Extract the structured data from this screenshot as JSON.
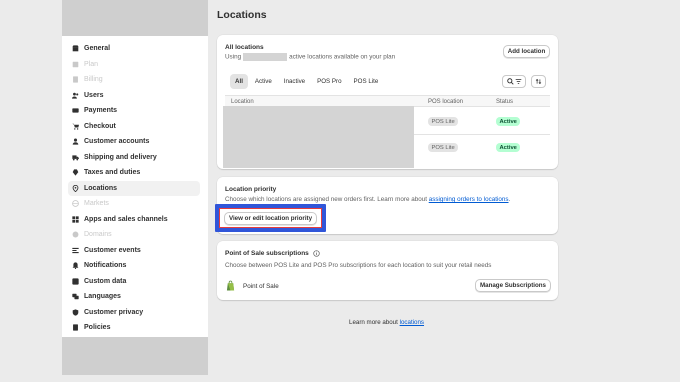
{
  "sidebar": {
    "items": [
      {
        "label": "General",
        "icon": "store-icon",
        "state": "normal"
      },
      {
        "label": "Plan",
        "icon": "plan-icon",
        "state": "disabled"
      },
      {
        "label": "Billing",
        "icon": "billing-icon",
        "state": "disabled"
      },
      {
        "label": "Users",
        "icon": "users-icon",
        "state": "normal"
      },
      {
        "label": "Payments",
        "icon": "payments-icon",
        "state": "normal"
      },
      {
        "label": "Checkout",
        "icon": "cart-icon",
        "state": "normal"
      },
      {
        "label": "Customer accounts",
        "icon": "person-icon",
        "state": "normal"
      },
      {
        "label": "Shipping and delivery",
        "icon": "truck-icon",
        "state": "normal"
      },
      {
        "label": "Taxes and duties",
        "icon": "tax-icon",
        "state": "normal"
      },
      {
        "label": "Locations",
        "icon": "location-icon",
        "state": "active"
      },
      {
        "label": "Markets",
        "icon": "globe-icon",
        "state": "disabled"
      },
      {
        "label": "Apps and sales channels",
        "icon": "apps-icon",
        "state": "normal"
      },
      {
        "label": "Domains",
        "icon": "domain-icon",
        "state": "disabled"
      },
      {
        "label": "Customer events",
        "icon": "events-icon",
        "state": "normal"
      },
      {
        "label": "Notifications",
        "icon": "bell-icon",
        "state": "normal"
      },
      {
        "label": "Custom data",
        "icon": "data-icon",
        "state": "normal"
      },
      {
        "label": "Languages",
        "icon": "language-icon",
        "state": "normal"
      },
      {
        "label": "Customer privacy",
        "icon": "privacy-icon",
        "state": "normal"
      },
      {
        "label": "Policies",
        "icon": "policies-icon",
        "state": "normal"
      }
    ]
  },
  "page": {
    "title": "Locations"
  },
  "all_locations": {
    "title": "All locations",
    "subtitle_prefix": "Using",
    "subtitle_suffix": "active locations available on your plan",
    "add_button": "Add location",
    "tabs": [
      "All",
      "Active",
      "Inactive",
      "POS Pro",
      "POS Lite"
    ],
    "selected_tab": "All",
    "columns": {
      "location": "Location",
      "pos": "POS location",
      "status": "Status"
    },
    "rows": [
      {
        "pos": "POS Lite",
        "status": "Active"
      },
      {
        "pos": "POS Lite",
        "status": "Active"
      }
    ]
  },
  "priority": {
    "title": "Location priority",
    "text": "Choose which locations are assigned new orders first. Learn more about",
    "link": "assigning orders to locations",
    "period": ".",
    "button": "View or edit location priority"
  },
  "pos": {
    "title": "Point of Sale subscriptions",
    "text": "Choose between POS Lite and POS Pro subscriptions for each location to suit your retail needs",
    "app_name": "Point of Sale",
    "button": "Manage Subscriptions"
  },
  "footer": {
    "text": "Learn more about",
    "link": "locations"
  },
  "colors": {
    "accent_link": "#005bd3",
    "active_badge": "#b4fed2",
    "highlight_blue": "#3156d9",
    "highlight_red": "#e63c3c"
  }
}
